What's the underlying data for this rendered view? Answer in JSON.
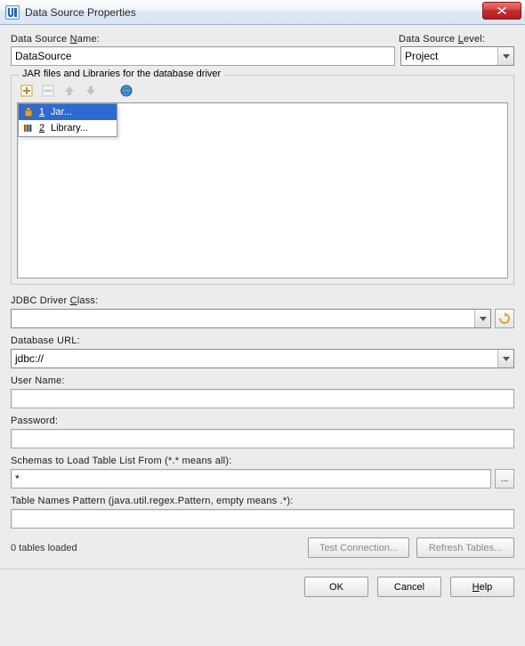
{
  "window": {
    "title": "Data Source Properties",
    "close_glyph": "X"
  },
  "labels": {
    "data_source_name": "Data Source Name:",
    "data_source_level": "Data Source Level:",
    "jar_group": "JAR files and Libraries for the database driver",
    "jdbc_driver_class": "JDBC Driver Class:",
    "database_url": "Database URL:",
    "user_name": "User Name:",
    "password": "Password:",
    "schemas": "Schemas to Load Table List From (*.* means all):",
    "table_pattern": "Table Names Pattern (java.util.regex.Pattern, empty means .*):"
  },
  "fields": {
    "data_source_name": "DataSource",
    "data_source_level": "Project",
    "jdbc_driver_class": "",
    "database_url": "jdbc://",
    "user_name": "",
    "password": "",
    "schemas": "*",
    "table_pattern": ""
  },
  "menu": {
    "jar": {
      "num": "1",
      "label": "Jar..."
    },
    "library": {
      "num": "2",
      "label": "Library..."
    }
  },
  "status": "0 tables loaded",
  "buttons": {
    "test_connection": "Test Connection...",
    "refresh_tables": "Refresh Tables...",
    "ok": "OK",
    "cancel": "Cancel",
    "help": "Help",
    "browse": "..."
  },
  "underline": {
    "N": "N",
    "ame": "ame:",
    "L": "L",
    "evel": "evel:",
    "C": "C",
    "lass": "lass:",
    "H": "H",
    "elp": "elp"
  }
}
